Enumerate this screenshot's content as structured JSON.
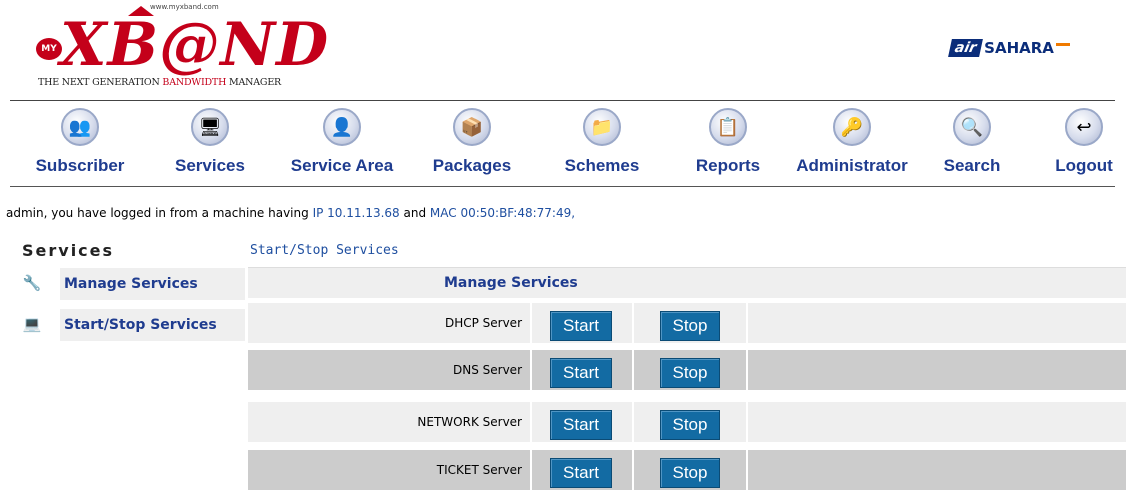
{
  "header": {
    "logo_url": "www.myxband.com",
    "logo_my": "MY",
    "logo_word_pre": "XB",
    "logo_word_at": "@",
    "logo_word_post": "ND",
    "logo_tagline_pre": "THE NEXT GENERATION ",
    "logo_tagline_hl": "BANDWIDTH",
    "logo_tagline_post": " MANAGER",
    "partner_prefix": "air",
    "partner_name": "SAHARA"
  },
  "nav": [
    {
      "label": "Subscriber",
      "icon": "subscriber-icon",
      "glyph": "👥"
    },
    {
      "label": "Services",
      "icon": "services-icon",
      "glyph": "🖥"
    },
    {
      "label": "Service Area",
      "icon": "service-area-icon",
      "glyph": "👤"
    },
    {
      "label": "Packages",
      "icon": "packages-icon",
      "glyph": "📦"
    },
    {
      "label": "Schemes",
      "icon": "schemes-icon",
      "glyph": "📁"
    },
    {
      "label": "Reports",
      "icon": "reports-icon",
      "glyph": "📋"
    },
    {
      "label": "Administrator",
      "icon": "administrator-icon",
      "glyph": "🔑"
    },
    {
      "label": "Search",
      "icon": "search-icon",
      "glyph": "🔍"
    },
    {
      "label": "Logout",
      "icon": "logout-icon",
      "glyph": "↩"
    }
  ],
  "login": {
    "prefix": "admin, you have logged in from a machine having ",
    "ip": "IP 10.11.13.68",
    "and": " and ",
    "mac": "MAC 00:50:BF:48:77:49,"
  },
  "sidebar": {
    "title": "Services",
    "items": [
      {
        "label": "Manage Services",
        "icon": "manage-services-icon",
        "glyph": "🔧"
      },
      {
        "label": "Start/Stop Services",
        "icon": "monitor-icon",
        "glyph": "💻"
      }
    ]
  },
  "main": {
    "breadcrumb": "Start/Stop Services",
    "panel_title": "Manage Services",
    "start_label": "Start",
    "stop_label": "Stop",
    "rows": [
      {
        "name": "DHCP Server"
      },
      {
        "name": "DNS Server"
      },
      {
        "name": "NETWORK Server"
      },
      {
        "name": "TICKET Server"
      }
    ]
  },
  "colors": {
    "brand_red": "#c4001a",
    "nav_blue": "#1f3c8f",
    "button_blue": "#136ba3",
    "partner_blue": "#0b2d7a"
  }
}
